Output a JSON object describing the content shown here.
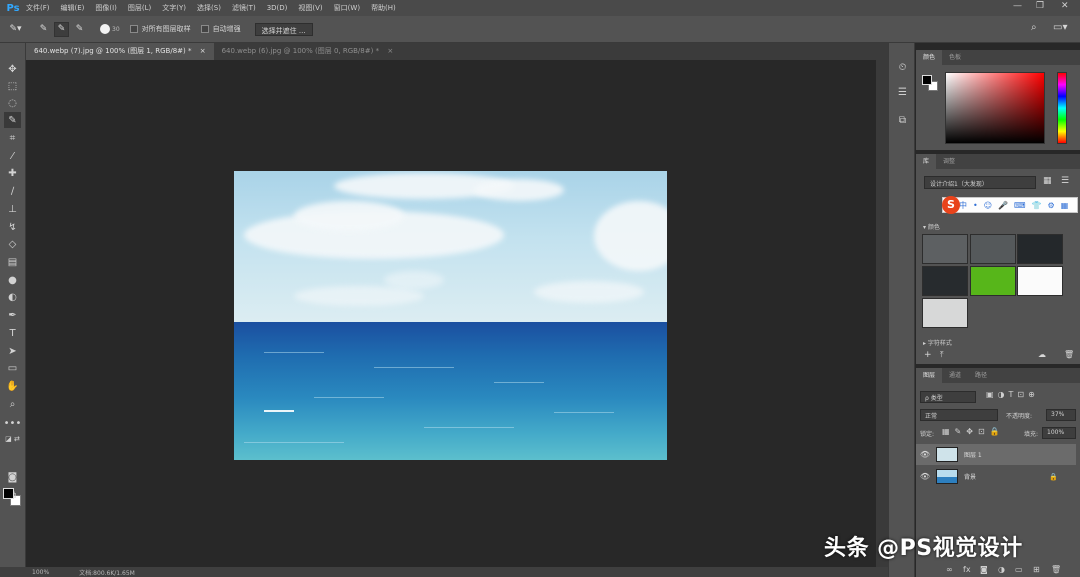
{
  "app": {
    "logo": "Ps"
  },
  "menu": [
    "文件(F)",
    "编辑(E)",
    "图像(I)",
    "图层(L)",
    "文字(Y)",
    "选择(S)",
    "滤镜(T)",
    "3D(D)",
    "视图(V)",
    "窗口(W)",
    "帮助(H)"
  ],
  "window_controls": {
    "minimize": "—",
    "restore": "❐",
    "close": "✕"
  },
  "options": {
    "brush_size": "30",
    "sample_all_layers": "对所有图层取样",
    "auto_enhance": "自动增强",
    "select_and_mask": "选择并遮住 ..."
  },
  "tabs": [
    {
      "label": "640.webp (7).jpg @ 100% (图层 1, RGB/8#) *",
      "close": "×"
    },
    {
      "label": "640.webp (6).jpg @ 100% (图层 0, RGB/8#) *",
      "close": "×"
    }
  ],
  "status": {
    "zoom": "100%",
    "doc": "文档:800.6K/1.65M"
  },
  "color_panel": {
    "tabs": [
      "颜色",
      "色板"
    ]
  },
  "libraries_panel": {
    "tabs": [
      "库",
      "调整"
    ],
    "library_select": "设计介绍1（大发现）",
    "ime_logo": "S",
    "ime_glyphs": [
      "中",
      "•",
      "☺",
      "🎤",
      "⌨",
      "👕",
      "⚙",
      "▦"
    ],
    "section_colors": "▾ 颜色",
    "section_char_styles": "▸ 字符样式",
    "swatches": [
      "#5d6062",
      "#55595b",
      "#24282b",
      "#272b2e",
      "#57b61a",
      "#fbfbfb",
      "#d7d8d8"
    ]
  },
  "layers_panel": {
    "tabs": [
      "图层",
      "通道",
      "路径"
    ],
    "kind_filter": "ρ 类型",
    "blend_mode": "正常",
    "opacity_label": "不透明度:",
    "opacity_value": "37%",
    "lock_label": "锁定:",
    "fill_label": "填充:",
    "fill_value": "100%",
    "layers": [
      {
        "name": "图层 1",
        "selected": true
      },
      {
        "name": "背景",
        "selected": false,
        "locked": true
      }
    ]
  },
  "watermark": "头条 @PS视觉设计"
}
